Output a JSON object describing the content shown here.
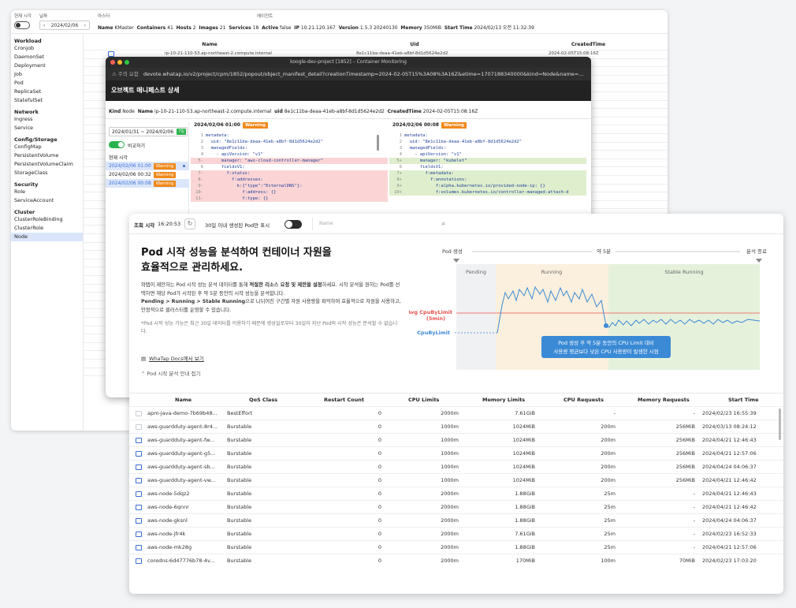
{
  "win1": {
    "labels": {
      "realtime": "현재 시각",
      "date": "날짜",
      "master": "마스터",
      "agent": "에이전트"
    },
    "date_value": "2024/02/06",
    "cluster": {
      "name_label": "Name",
      "name": "KMaster",
      "containers_label": "Containers",
      "containers": "41",
      "hosts_label": "Hosts",
      "hosts": "2",
      "images_label": "Images",
      "images": "21",
      "services_label": "Services",
      "services": "18",
      "active_label": "Active",
      "active": "false",
      "ip_label": "IP",
      "ip": "10.21.120.167",
      "version_label": "Version",
      "version": "1.5.3 20240130",
      "memory_label": "Memory",
      "memory": "350MiB",
      "start_label": "Start Time",
      "start": "2024/02/13 오전 11:32:39"
    },
    "sidebar": [
      {
        "type": "h",
        "label": "Workload"
      },
      {
        "type": "i",
        "label": "Cronjob"
      },
      {
        "type": "i",
        "label": "DaemonSet"
      },
      {
        "type": "i",
        "label": "Deployment"
      },
      {
        "type": "i",
        "label": "Job"
      },
      {
        "type": "i",
        "label": "Pod"
      },
      {
        "type": "i",
        "label": "ReplicaSet"
      },
      {
        "type": "i",
        "label": "StatefulSet"
      },
      {
        "type": "h",
        "label": "Network"
      },
      {
        "type": "i",
        "label": "Ingress"
      },
      {
        "type": "i",
        "label": "Service"
      },
      {
        "type": "h",
        "label": "Config/Storage"
      },
      {
        "type": "i",
        "label": "ConfigMap"
      },
      {
        "type": "i",
        "label": "PersistentVolume"
      },
      {
        "type": "i",
        "label": "PersistentVolumeClaim"
      },
      {
        "type": "i",
        "label": "StorageClass"
      },
      {
        "type": "h",
        "label": "Security"
      },
      {
        "type": "i",
        "label": "Role"
      },
      {
        "type": "i",
        "label": "ServiceAccount"
      },
      {
        "type": "h",
        "label": "Cluster"
      },
      {
        "type": "i",
        "label": "ClusterRoleBinding"
      },
      {
        "type": "i",
        "label": "ClusterRole"
      },
      {
        "type": "i",
        "label": "Node",
        "selected": true
      }
    ],
    "table": {
      "headers": [
        "Name",
        "Uid",
        "CreatedTime"
      ],
      "first_row": {
        "name": "ip-10-21-110-53.ap-northeast-2.compute.internal",
        "uid": "8e1c11ba-deaa-41eb-a8bf-8d1d5624e2d2",
        "time": "2024-02-05T15:08:16Z"
      },
      "times": [
        "T15:32:12Z",
        "T15:36:33Z",
        "T16:29:14Z",
        "T18:52:00Z",
        "T19:32:59Z",
        "T19:35:04Z",
        "T22:39:14Z",
        "T23:19:25Z",
        "T23:47:21Z",
        "T23:47:30Z",
        "T00:19:23Z",
        "T00:21:27Z",
        "T00:24:27Z"
      ]
    }
  },
  "win2": {
    "title": "koogle-dev-project [1852] – Container Monitoring",
    "url_warning": "⚠ 주의 요함",
    "url": "devote.whatap.io/v2/project/cpm/1852/popout/object_manifest_detail?creationTimestamp=2024-02-05T15%3A08%3A16Z&etime=1707188340000&kind=Node&name=...",
    "header": "오브젝트 매니페스트 상세",
    "kind_label": "Kind",
    "kind": "Node",
    "name_label": "Name",
    "name": "ip-10-21-110-53.ap-northeast-2.compute.internal",
    "uid_label": "uid",
    "uid": "8e1c11ba-deaa-41eb-a8bf-8d1d5624e2d2",
    "created_label": "CreatedTime",
    "created": "2024-02-05T15:08:16Z",
    "date_range": "2024/01/31 ~ 2024/02/06",
    "today": "7일",
    "compare": "비교하기",
    "list_title": "현재 시각",
    "list": [
      {
        "time": "2024/02/06 01:00",
        "badge": "Warning",
        "style": "a"
      },
      {
        "time": "2024/02/06 00:32",
        "badge": "Warning",
        "style": "b"
      },
      {
        "time": "2024/02/06 00:08",
        "badge": "Warning",
        "style": "c"
      }
    ],
    "left_head": "2024/02/06 01:00",
    "right_head": "2024/02/06 00:08",
    "head_badge": "Warning",
    "left_lines": [
      {
        "n": "1",
        "t": "metadata:",
        "c": ""
      },
      {
        "n": "2",
        "t": "  uid: \"8e1c11ba-deaa-41eb-a8bf-8d1d5624e2d2\"",
        "c": ""
      },
      {
        "n": "3",
        "t": "  managedFields:",
        "c": ""
      },
      {
        "n": "4",
        "t": "    - apiVersion: \"v1\"",
        "c": ""
      },
      {
        "n": "5-",
        "t": "      manager: \"aws-cloud-controller-manager\"",
        "c": "red"
      },
      {
        "n": "6",
        "t": "      fieldsV1:",
        "c": ""
      },
      {
        "n": "7-",
        "t": "        f:status:",
        "c": "red"
      },
      {
        "n": "8-",
        "t": "          f:addresses:",
        "c": "red"
      },
      {
        "n": "9-",
        "t": "            k:{\"type\":\"ExternalDNS\"}:",
        "c": "red"
      },
      {
        "n": "10-",
        "t": "              f:address: {}",
        "c": "red"
      },
      {
        "n": "11-",
        "t": "              f:type: {}",
        "c": "red"
      }
    ],
    "right_lines": [
      {
        "n": "1",
        "t": "metadata:",
        "c": ""
      },
      {
        "n": "2",
        "t": "  uid: \"8e1c11ba-deaa-41eb-a8bf-8d1d5624e2d2\"",
        "c": ""
      },
      {
        "n": "3",
        "t": "  managedFields:",
        "c": ""
      },
      {
        "n": "4",
        "t": "    - apiVersion: \"v1\"",
        "c": ""
      },
      {
        "n": "5+",
        "t": "      manager: \"kubelet\"",
        "c": "green"
      },
      {
        "n": "6",
        "t": "      fieldsV1:",
        "c": ""
      },
      {
        "n": "7+",
        "t": "        f:metadata:",
        "c": "green"
      },
      {
        "n": "8+",
        "t": "          f:annotations:",
        "c": "green"
      },
      {
        "n": "9+",
        "t": "            f:alpha.kubernetes.io/provided-node-ip: {}",
        "c": "green"
      },
      {
        "n": "10+",
        "t": "            f:volumes.kubernetes.io/controller-managed-attach-d",
        "c": "green"
      }
    ]
  },
  "win3": {
    "query_label": "조회 시각",
    "query_time": "16:20:53",
    "toggle_label": "30일 이내 생성된 Pod만 표시",
    "name_placeholder": "Name",
    "h1_line1": "Pod 시작 성능을 분석하여 컨테이너 자원을",
    "h1_line2": "효율적으로 관리하세요.",
    "desc_1": "와탭이 제안하는 Pod 시작 성능 분석 데이터를 통해 ",
    "desc_b1": "적절한 리소스 요청 및 제한을 설정",
    "desc_2": "하세요. 시작 분석을 원하는 Pod를 선택하면 해당 Pod가 시작된 후 약 5분 동안의 시작 성능을 분석합니다.",
    "desc_b2": "Pending > Running > Stable Running",
    "desc_3": "으로 나뉘어진 구간별 자원 사용량을 파악하여 효율적으로 자원을 사용하고, 안정적으로 클러스터를 운영할 수 있습니다.",
    "note": "*Pod 시작 성능 기능은 최근 30일 데이터를 이용하기 때문에 생성일로부터 30일이 지난 Pod의 시작 성능은 분석할 수 없습니다.",
    "docs_link": "WhaTap Docs에서 보기",
    "guide_toggle": "Pod 시작 분석 안내 접기",
    "diagram": {
      "pod_create": "Pod 생성",
      "approx": "약 5분",
      "analysis_end": "분석 종료",
      "pending": "Pending",
      "running": "Running",
      "stable": "Stable Running",
      "avg_cpu": "Avg CpuByLimit",
      "avg_cpu_2": "(5min)",
      "cpu_by_limit": "CpuByLimit",
      "tooltip_1": "Pod 생성 후 약 5분 동안의 CPU Limit 대비",
      "tooltip_2": "사용량 평균보다 낮은 CPU 사용량이 발생한 시점"
    },
    "table": {
      "headers": [
        "Name",
        "QoS Class",
        "Restart Count",
        "CPU Limits",
        "Memory Limits",
        "CPU Requests",
        "Memory Requests",
        "Start Time"
      ],
      "rows": [
        [
          "apm-java-demo-7b69b48...",
          "BestEffort",
          "0",
          "2000m",
          "7.61GiB",
          "-",
          "-",
          "2024/02/23 16:55:39"
        ],
        [
          "aws-guardduty-agent-8r4...",
          "Burstable",
          "0",
          "1000m",
          "1024MiB",
          "200m",
          "256MiB",
          "2024/03/13 08:24:12"
        ],
        [
          "aws-guardduty-agent-fw...",
          "Burstable",
          "0",
          "1000m",
          "1024MiB",
          "200m",
          "256MiB",
          "2024/04/21 12:46:43"
        ],
        [
          "aws-guardduty-agent-g5...",
          "Burstable",
          "0",
          "1000m",
          "1024MiB",
          "200m",
          "256MiB",
          "2024/04/21 12:57:06"
        ],
        [
          "aws-guardduty-agent-sb...",
          "Burstable",
          "0",
          "1000m",
          "1024MiB",
          "200m",
          "256MiB",
          "2024/04/24 04:06:37"
        ],
        [
          "aws-guardduty-agent-vw...",
          "Burstable",
          "0",
          "1000m",
          "1024MiB",
          "200m",
          "256MiB",
          "2024/04/21 12:46:42"
        ],
        [
          "aws-node-5dqz2",
          "Burstable",
          "0",
          "2000m",
          "1.88GiB",
          "25m",
          "-",
          "2024/04/21 12:46:43"
        ],
        [
          "aws-node-6qnnr",
          "Burstable",
          "0",
          "2000m",
          "1.88GiB",
          "25m",
          "-",
          "2024/04/21 12:46:42"
        ],
        [
          "aws-node-gksnl",
          "Burstable",
          "0",
          "2000m",
          "1.88GiB",
          "25m",
          "-",
          "2024/04/24 04:06:37"
        ],
        [
          "aws-node-jfr4k",
          "Burstable",
          "0",
          "2000m",
          "7.61GiB",
          "25m",
          "-",
          "2024/02/23 16:52:33"
        ],
        [
          "aws-node-mk28g",
          "Burstable",
          "0",
          "2000m",
          "1.88GiB",
          "25m",
          "-",
          "2024/04/21 12:57:06"
        ],
        [
          "coredns-6d47776b78-4v...",
          "Burstable",
          "0",
          "2000m",
          "170MiB",
          "100m",
          "70MiB",
          "2024/02/23 17:03:20"
        ]
      ],
      "active_rows": [
        2,
        3,
        4,
        5,
        6,
        7,
        8,
        9,
        10,
        11
      ]
    }
  },
  "colors": {
    "accent": "#3b6fd6",
    "warning": "#f0881a",
    "green": "#2bb24c"
  }
}
